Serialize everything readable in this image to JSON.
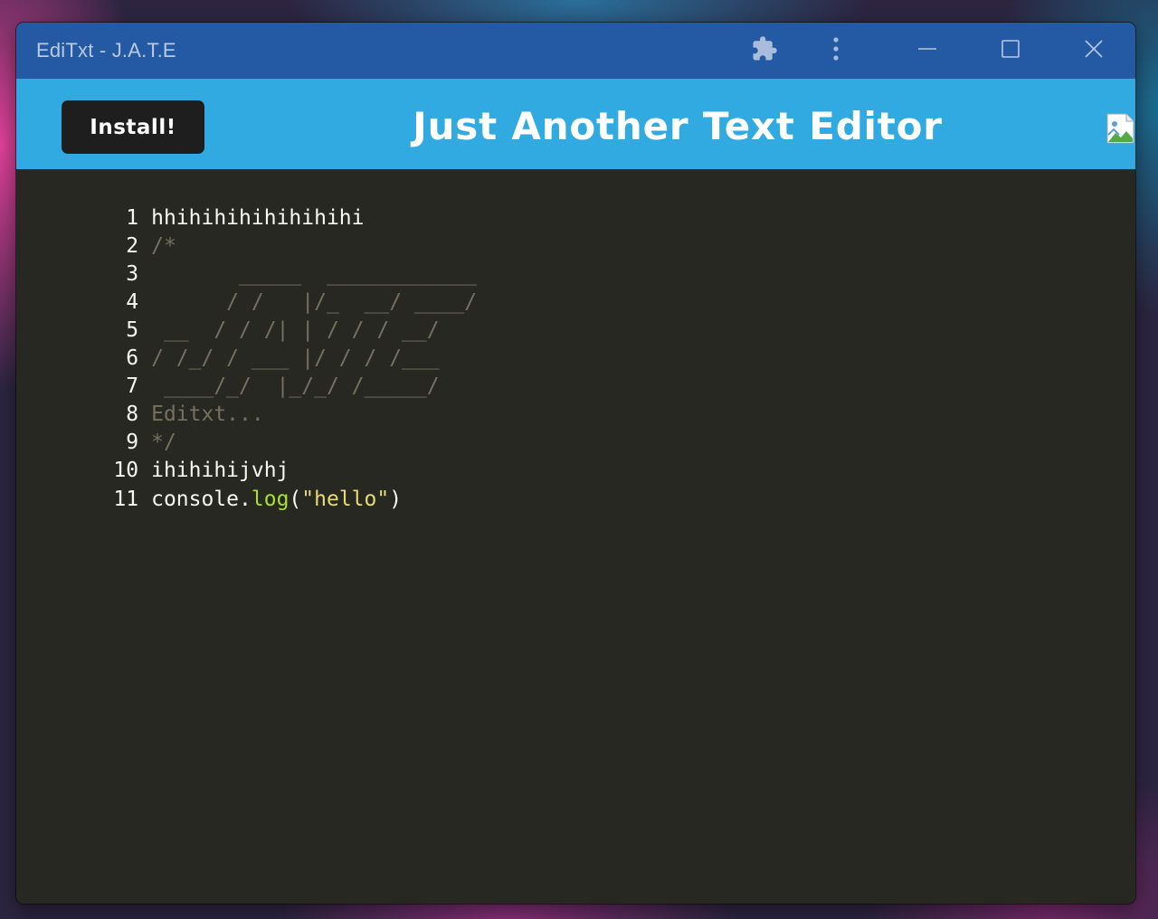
{
  "window": {
    "title": "EdiTxt - J.A.T.E",
    "controls": {
      "extensions_icon": "puzzle-icon",
      "more_icon": "more-vertical-icon",
      "minimize_icon": "minimize-icon",
      "maximize_icon": "maximize-icon",
      "close_icon": "close-icon"
    }
  },
  "header": {
    "install_label": "Install!",
    "title": "Just Another Text Editor",
    "logo_icon": "broken-image-icon",
    "background_color": "#31a9e1",
    "button_color": "#1e1e1e"
  },
  "colors": {
    "titlebar": "#245aa4",
    "editor_bg": "#272822",
    "text": "#f8f8f2",
    "comment": "#75715e",
    "function": "#a6e22e",
    "string": "#e6db74"
  },
  "editor": {
    "lines": [
      {
        "num": "1",
        "text": "hhihihihihihihihi"
      },
      {
        "num": "2",
        "text": "/*"
      },
      {
        "num": "3",
        "text": "       _____  ____________"
      },
      {
        "num": "4",
        "text": "      / /   |/_  __/ ____/"
      },
      {
        "num": "5",
        "text": " __  / / /| | / / / __/"
      },
      {
        "num": "6",
        "text": "/ /_/ / ___ |/ / / /___"
      },
      {
        "num": "7",
        "text": " ____/_/  |_/_/ /_____/"
      },
      {
        "num": "8",
        "text": "Editxt..."
      },
      {
        "num": "9",
        "text": "*/"
      },
      {
        "num": "10",
        "text": "ihihihijvhj"
      },
      {
        "num": "11",
        "code_parts": {
          "object": "console.",
          "method": "log",
          "open": "(",
          "string": "\"hello\"",
          "close": ")"
        }
      }
    ]
  }
}
